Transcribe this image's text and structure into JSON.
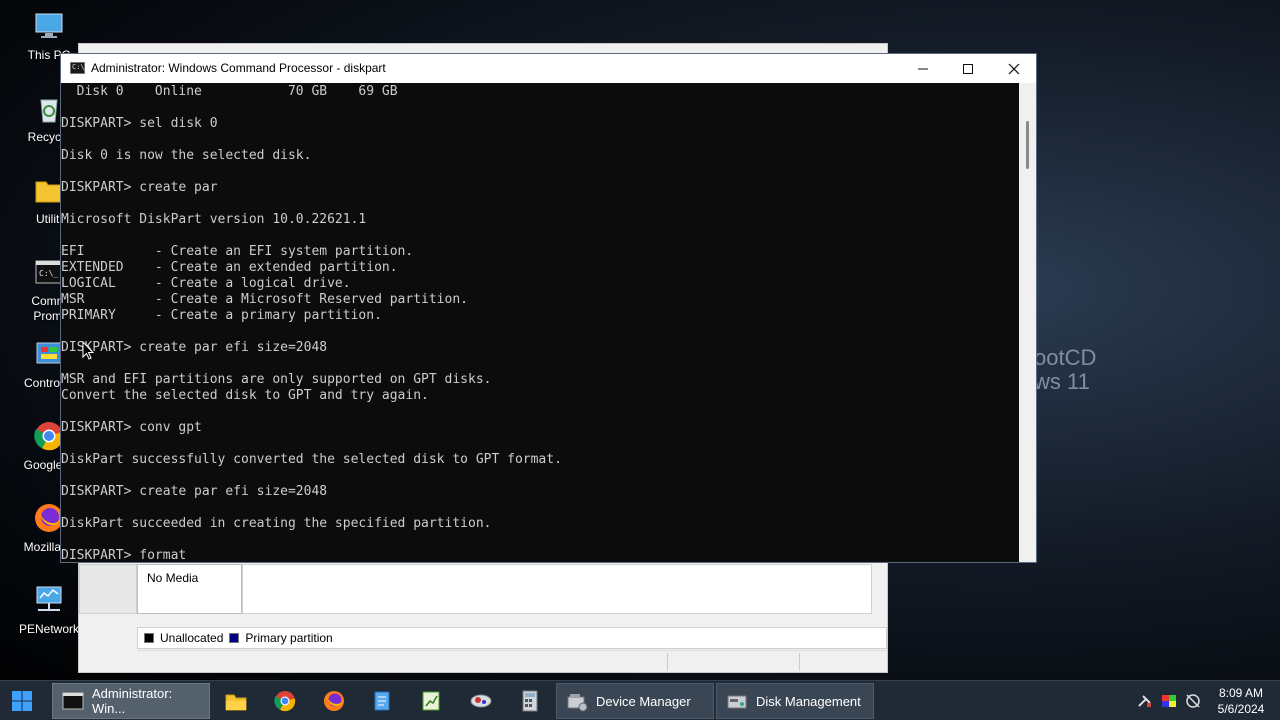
{
  "desktop": {
    "icons": [
      {
        "label": "This PC",
        "icon": "computer-icon"
      },
      {
        "label": "Recycle",
        "icon": "recycle-bin-icon"
      },
      {
        "label": "Utiliti",
        "icon": "folder-icon"
      },
      {
        "label": "Comm\nPromi",
        "icon": "command-prompt-icon"
      },
      {
        "label": "Control P",
        "icon": "control-panel-icon"
      },
      {
        "label": "Google C",
        "icon": "chrome-icon"
      },
      {
        "label": "Mozilla Fi",
        "icon": "firefox-icon"
      },
      {
        "label": "PENetwork",
        "icon": "network-icon"
      }
    ],
    "watermark": [
      "ootCD",
      "ws 11"
    ]
  },
  "console": {
    "title": "Administrator: Windows Command Processor - diskpart",
    "lines": [
      "  Disk 0    Online           70 GB    69 GB",
      "",
      "DISKPART> sel disk 0",
      "",
      "Disk 0 is now the selected disk.",
      "",
      "DISKPART> create par",
      "",
      "Microsoft DiskPart version 10.0.22621.1",
      "",
      "EFI         - Create an EFI system partition.",
      "EXTENDED    - Create an extended partition.",
      "LOGICAL     - Create a logical drive.",
      "MSR         - Create a Microsoft Reserved partition.",
      "PRIMARY     - Create a primary partition.",
      "",
      "DISKPART> create par efi size=2048",
      "",
      "MSR and EFI partitions are only supported on GPT disks.",
      "Convert the selected disk to GPT and try again.",
      "",
      "DISKPART> conv gpt",
      "",
      "DiskPart successfully converted the selected disk to GPT format.",
      "",
      "DISKPART> create par efi size=2048",
      "",
      "DiskPart succeeded in creating the specified partition.",
      "",
      "DISKPART> format"
    ]
  },
  "disk_management": {
    "media_text": "No Media",
    "legend": [
      {
        "label": "Unallocated",
        "color": "#000000"
      },
      {
        "label": "Primary partition",
        "color": "#000080"
      }
    ]
  },
  "taskbar": {
    "start_icon": "windows-start-icon",
    "tasks": [
      {
        "label": "Administrator: Win...",
        "icon": "command-prompt-icon",
        "active": true
      },
      {
        "label": "Device Manager",
        "icon": "device-manager-icon",
        "active": false
      },
      {
        "label": "Disk Management",
        "icon": "disk-management-icon",
        "active": false
      }
    ],
    "pinned": [
      "file-explorer-icon",
      "chrome-icon",
      "firefox-icon",
      "notepad-icon",
      "spreadsheet-icon",
      "network-tool-icon",
      "calculator-icon"
    ],
    "clock": {
      "time": "8:09 AM",
      "date": "5/6/2024"
    }
  }
}
